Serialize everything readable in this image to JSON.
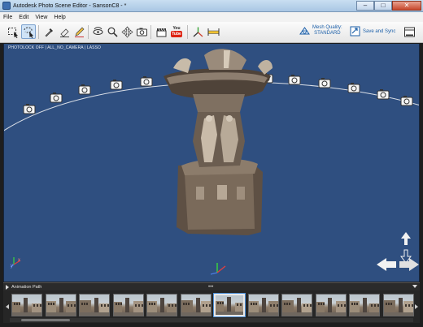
{
  "window": {
    "title": "Autodesk Photo Scene Editor - SansonC8 - *",
    "controls": [
      "minimize",
      "maximize",
      "close"
    ]
  },
  "menu": [
    "File",
    "Edit",
    "View",
    "Help"
  ],
  "toolbar": {
    "tools": [
      {
        "icon": "rectangle-select-icon"
      },
      {
        "icon": "lasso-select-icon",
        "active": true
      },
      {
        "icon": "eyedropper-icon"
      },
      {
        "icon": "eraser-icon"
      },
      {
        "icon": "pencil-icon"
      },
      {
        "icon": "orbit-icon"
      },
      {
        "icon": "zoom-icon"
      },
      {
        "icon": "pan-icon"
      },
      {
        "icon": "camera-icon"
      },
      {
        "icon": "clapperboard-icon"
      },
      {
        "icon": "youtube-icon"
      },
      {
        "icon": "axis-icon"
      },
      {
        "icon": "measure-icon"
      }
    ],
    "youtube_label_top": "You",
    "youtube_label_badge": "Tube",
    "mesh_quality_label": "Mesh Quality:",
    "mesh_quality_value": "STANDARD",
    "save_sync_label": "Save and Sync"
  },
  "viewport": {
    "status": "PHOTOLOCK OFF | ALL_NO_CAMERA | LASSO",
    "background": "#2f4f80"
  },
  "animation_path": {
    "label": "Animation Path",
    "grip": "•••"
  },
  "filmstrip": {
    "thumbnail_count": 12,
    "selected_index": 6
  }
}
